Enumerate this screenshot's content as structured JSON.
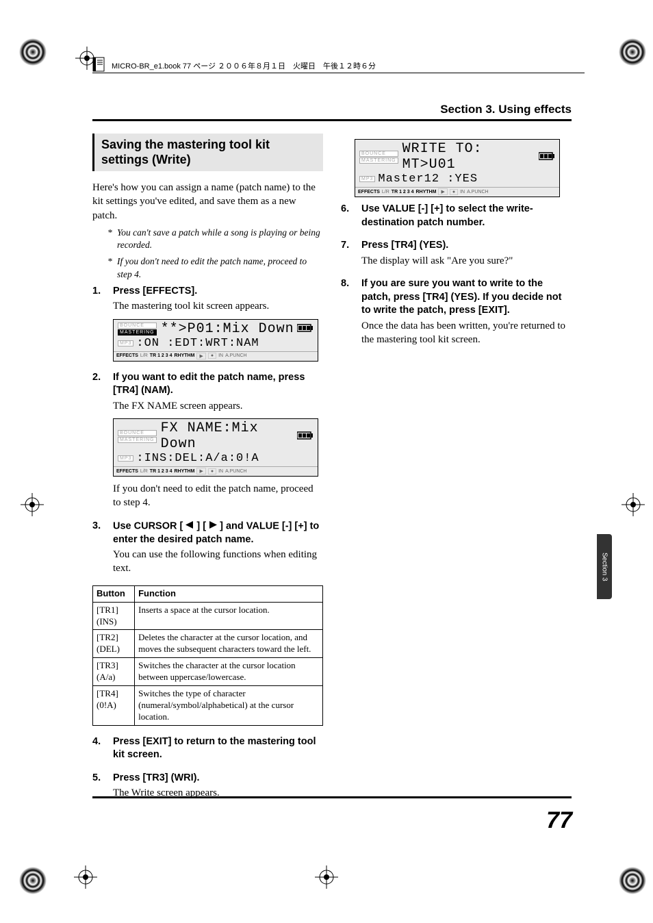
{
  "headerFile": "MICRO-BR_e1.book 77 ページ ２００６年８月１日　火曜日　午後１２時６分",
  "sectionHeader": "Section 3. Using effects",
  "titleBlock": "Saving the mastering tool kit settings (Write)",
  "intro": "Here's how you can assign a name (patch name) to the kit settings you've edited, and save them as a new patch.",
  "notes": [
    "You can't save a patch while a song is playing or being recorded.",
    "If you don't need to edit the patch name, proceed to step 4."
  ],
  "steps": {
    "s1": {
      "num": "1.",
      "head": "Press [EFFECTS].",
      "body": "The mastering tool kit screen appears."
    },
    "s2": {
      "num": "2.",
      "head": "If you want to edit the patch name, press [TR4] (NAM).",
      "body": "The FX NAME screen appears."
    },
    "s2b": "If you don't need to edit the patch name, proceed to step 4.",
    "s3": {
      "num": "3.",
      "headA": "Use CURSOR [",
      "headB": "] [",
      "headC": "] and VALUE [-] [+] to enter the desired patch name.",
      "body": "You can use the following functions when editing text."
    },
    "s4": {
      "num": "4.",
      "head": "Press [EXIT] to return to the mastering tool kit screen."
    },
    "s5": {
      "num": "5.",
      "head": "Press [TR3] (WRI).",
      "body": "The Write screen appears."
    },
    "s6": {
      "num": "6.",
      "head": "Use VALUE [-] [+] to select the write-destination patch number."
    },
    "s7": {
      "num": "7.",
      "head": "Press [TR4] (YES).",
      "body": "The display will ask \"Are you sure?\""
    },
    "s8": {
      "num": "8.",
      "head": "If you are sure you want to write to the patch, press [TR4] (YES). If you decide not to write the patch, press [EXIT].",
      "body": "Once the data has been written, you're returned to the mastering tool kit screen."
    }
  },
  "lcd1": {
    "line1": "**>P01:Mix Down",
    "line2": ":ON :EDT:WRT:NAM"
  },
  "lcd2": {
    "line1": "FX NAME:Mix Down",
    "line2": ":INS:DEL:A/a:0!A"
  },
  "lcd3": {
    "line1": "WRITE TO: MT>U01",
    "line2": " Master12    :YES"
  },
  "lcdBottom": {
    "effects": "EFFECTS",
    "lr": "L/R",
    "tr": "TR 1 2 3 4",
    "rhythm": "RHYTHM",
    "in": "IN",
    "apunch": "A.PUNCH"
  },
  "lcdBadges": {
    "bounce": "BOUNCE",
    "mastering": "MASTERING",
    "mp3": "MP3"
  },
  "table": {
    "headers": {
      "button": "Button",
      "function": "Function"
    },
    "rows": [
      {
        "button": "[TR1] (INS)",
        "function": "Inserts a space at the cursor location."
      },
      {
        "button": "[TR2] (DEL)",
        "function": "Deletes the character at the cursor location, and moves the subsequent characters toward the left."
      },
      {
        "button": "[TR3] (A/a)",
        "function": "Switches the character at the cursor location between uppercase/lowercase."
      },
      {
        "button": "[TR4] (0!A)",
        "function": "Switches the type of character (numeral/symbol/alphabetical) at the cursor location."
      }
    ]
  },
  "sideTab": "Section 3",
  "pageNum": "77"
}
